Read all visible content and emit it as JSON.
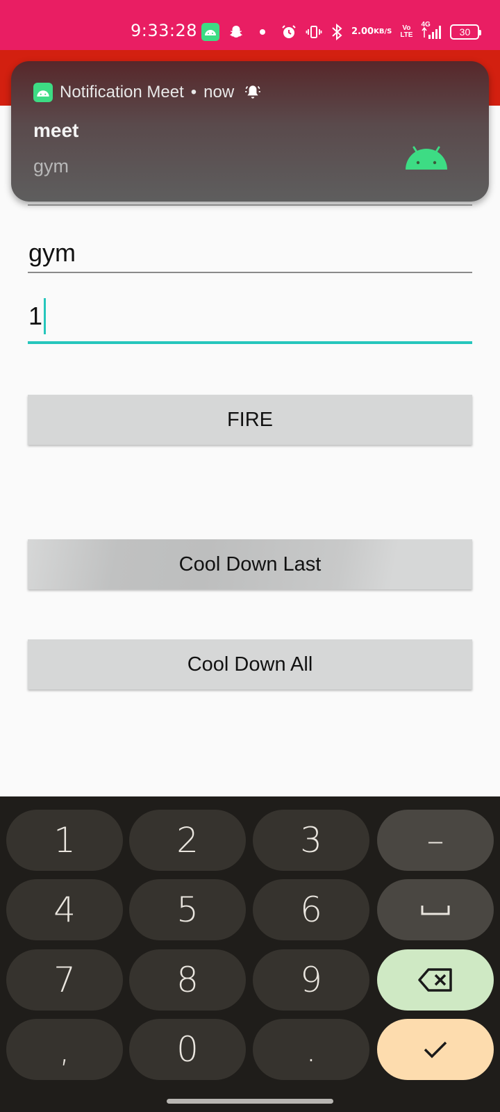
{
  "status_bar": {
    "time": "9:33:28",
    "net_speed_value": "2.00",
    "net_speed_unit": "KB/S",
    "volte_top": "Vo",
    "volte_bottom": "LTE",
    "network_type": "4G",
    "battery": "30",
    "icons": [
      "android-app-icon",
      "snapchat-icon",
      "dot-icon",
      "alarm-icon",
      "vibrate-icon",
      "bluetooth-icon",
      "signal-icon",
      "battery-icon"
    ]
  },
  "notification": {
    "app_name": "Notification Meet",
    "separator": "•",
    "time": "now",
    "title": "meet",
    "text": "gym",
    "accent": "#3ddc84"
  },
  "form": {
    "gym_value": "gym",
    "number_value": "1",
    "fire_label": "FIRE",
    "cool_down_last_label": "Cool Down Last",
    "cool_down_all_label": "Cool Down All"
  },
  "keyboard": {
    "keys": {
      "k1": "1",
      "k2": "2",
      "k3": "3",
      "minus": "–",
      "k4": "4",
      "k5": "5",
      "k6": "6",
      "k7": "7",
      "k8": "8",
      "k9": "9",
      "comma": ",",
      "k0": "0",
      "period": "."
    }
  },
  "colors": {
    "status_bar": "#e91e63",
    "app_bar": "#d32010",
    "focus_accent": "#26c6bc",
    "button_bg": "#d6d7d7"
  }
}
